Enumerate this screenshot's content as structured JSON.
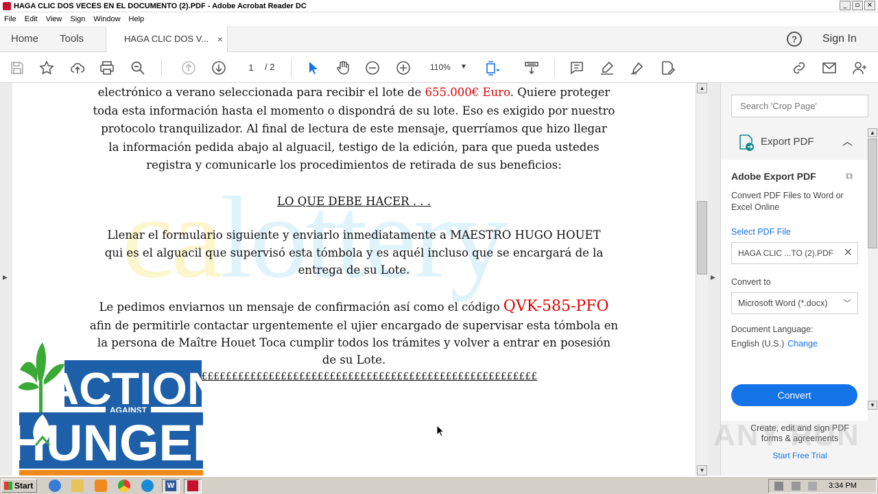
{
  "window": {
    "title": "HAGA CLIC DOS VECES EN EL DOCUMENTO (2).PDF - Adobe Acrobat Reader DC",
    "buttons": [
      "_",
      "▫",
      "×"
    ]
  },
  "menu": [
    "File",
    "Edit",
    "View",
    "Sign",
    "Window",
    "Help"
  ],
  "tabs": {
    "home": "Home",
    "tools": "Tools",
    "doc": "HAGA CLIC DOS V...",
    "close": "×",
    "help": "?",
    "signin": "Sign In"
  },
  "toolbar": {
    "page_current": "1",
    "page_total": "/ 2",
    "zoom": "110%"
  },
  "document": {
    "para1": [
      {
        "text": "electrónico a verano seleccionada para recibir el lote de "
      },
      {
        "text": "655.000€ Euro",
        "red": true
      },
      {
        "text": ". Quiere proteger"
      }
    ],
    "para1_lines": [
      "toda esta información hasta el momento o dispondrá de su lote. Eso es exigido por nuestro",
      "protocolo tranquilizador. Al final de lectura de este mensaje, querríamos que hizo llegar",
      "la información pedida abajo al alguacil, testigo de la edición, para que pueda ustedes",
      "registra y comunicarle los procedimientos de retirada de sus beneficios:"
    ],
    "heading": "LO QUE DEBE HACER . . .",
    "para2": [
      "Llenar el formulario siguiente y enviarlo inmediatamente a MAESTRO HUGO HOUET",
      "qui es el alguacil que supervisó esta tómbola y es aquél incluso que se encargará de la",
      "entrega de su Lote."
    ],
    "para3_first": "Le pedimos enviarnos un mensaje de confirmación así como el código ",
    "code": "QVK-585-PFO",
    "para3": [
      "afin de permitirle contactar urgentemente el ujier encargado de supervisar esta tómbola en",
      "la persona de Maître Houet Toca cumplir todos los trámites y volver a entrar en posesión",
      "de su Lote."
    ],
    "separator": "££££££££££££££££££££££££££££££££££££££££££££££££££££££££££££",
    "watermark": "calottery",
    "logo": {
      "line1": "ACTION",
      "line2": "AGAINST",
      "line3": "HUNGER"
    }
  },
  "right_panel": {
    "search_placeholder": "Search 'Crop Page'",
    "export_label": "Export PDF",
    "title": "Adobe Export PDF",
    "description": "Convert PDF Files to Word or Excel Online",
    "select_label": "Select PDF File",
    "file_name": "HAGA CLIC ...TO (2).PDF",
    "convert_to_label": "Convert to",
    "convert_to_value": "Microsoft Word (*.docx)",
    "language_label": "Document Language:",
    "language_value": "English (U.S.)",
    "change": "Change",
    "convert_button": "Convert",
    "promo_line1": "Create, edit and sign PDF",
    "promo_line2": "forms & agreements",
    "promo_link": "Start Free Trial"
  },
  "overlay_watermark": "ANY RUN",
  "taskbar": {
    "start": "Start",
    "time": "3:34 PM"
  },
  "colors": {
    "accent": "#1473e6",
    "red_text": "#e10000",
    "logo_blue": "#1d5fa8",
    "logo_green": "#3aa935"
  }
}
